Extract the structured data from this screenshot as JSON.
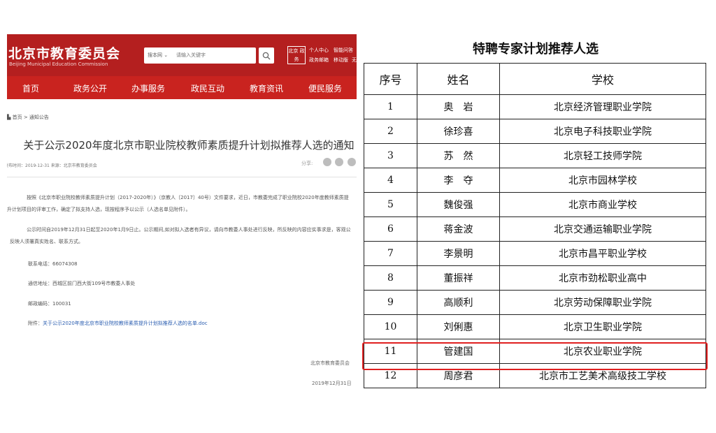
{
  "site": {
    "logo_cn": "北京市教育委员会",
    "logo_en": "Beijing Municipal Education Commission",
    "search_scope": "搜本网",
    "search_placeholder": "请输入关键字",
    "header_links": [
      "个人中心",
      "智能问答",
      "政务邮箱",
      "移动版",
      "无"
    ],
    "emblem_text": "北京 政务",
    "nav": [
      "首页",
      "政务公开",
      "办事服务",
      "政民互动",
      "教育资讯",
      "便民服务"
    ],
    "breadcrumb": "首页 > 通知公告",
    "article_title": "关于公示2020年度北京市职业院校教师素质提升计划拟推荐人选的通知",
    "meta": "发布时间：2019-12-31    来源：北京市教育委员会",
    "share_label": "分享:",
    "paragraph1": "按照《北京市职业院校教师素质提升计划（2017-2020年）》（京教人〔2017〕40号）文件要求，近日，市教委完成了职业院校2020年度教师素质提升计划项目的评审工作，确定了拟支持人选，现按程序予以公示（人选名单见附件）。",
    "paragraph2": "公示时间自2019年12月31日起至2020年1月9日止。公示期间,如对拟入选者有异议，请向市教委人事处进行反映，所反映的内容应实事求是，客观公正，反映人须署真实姓名、联系方式。",
    "phone": "联系电话：66074308",
    "address": "通信地址：西城区前门西大街109号市教委人事处",
    "postcode": "邮政编码：100031",
    "attachment_label": "附件：",
    "attachment_link": "关于公示2020年度北京市职业院校教师素质提升计划拟推荐人选的名单.doc",
    "signature": "北京市教育委员会",
    "sign_date": "2019年12月31日"
  },
  "table": {
    "title": "特聘专家计划推荐人选",
    "headers": [
      "序号",
      "姓名",
      "学校"
    ],
    "rows": [
      [
        "1",
        "奥　岩",
        "北京经济管理职业学院"
      ],
      [
        "2",
        "徐珍喜",
        "北京电子科技职业学院"
      ],
      [
        "3",
        "苏　然",
        "北京轻工技师学院"
      ],
      [
        "4",
        "李　夺",
        "北京市园林学校"
      ],
      [
        "5",
        "魏俊强",
        "北京市商业学校"
      ],
      [
        "6",
        "蒋金波",
        "北京交通运输职业学院"
      ],
      [
        "7",
        "李景明",
        "北京市昌平职业学校"
      ],
      [
        "8",
        "董振祥",
        "北京市劲松职业高中"
      ],
      [
        "9",
        "高顺利",
        "北京劳动保障职业学院"
      ],
      [
        "10",
        "刘俐惠",
        "北京卫生职业学院"
      ],
      [
        "11",
        "管建国",
        "北京农业职业学院"
      ],
      [
        "12",
        "周彦君",
        "北京市工艺美术高级技工学校"
      ]
    ],
    "highlighted_row": "11",
    "highlight_color": "#e02020"
  },
  "colors": {
    "header_red": "#b41f1f",
    "nav_red": "#c9231f",
    "link_blue": "#2a5db0"
  }
}
